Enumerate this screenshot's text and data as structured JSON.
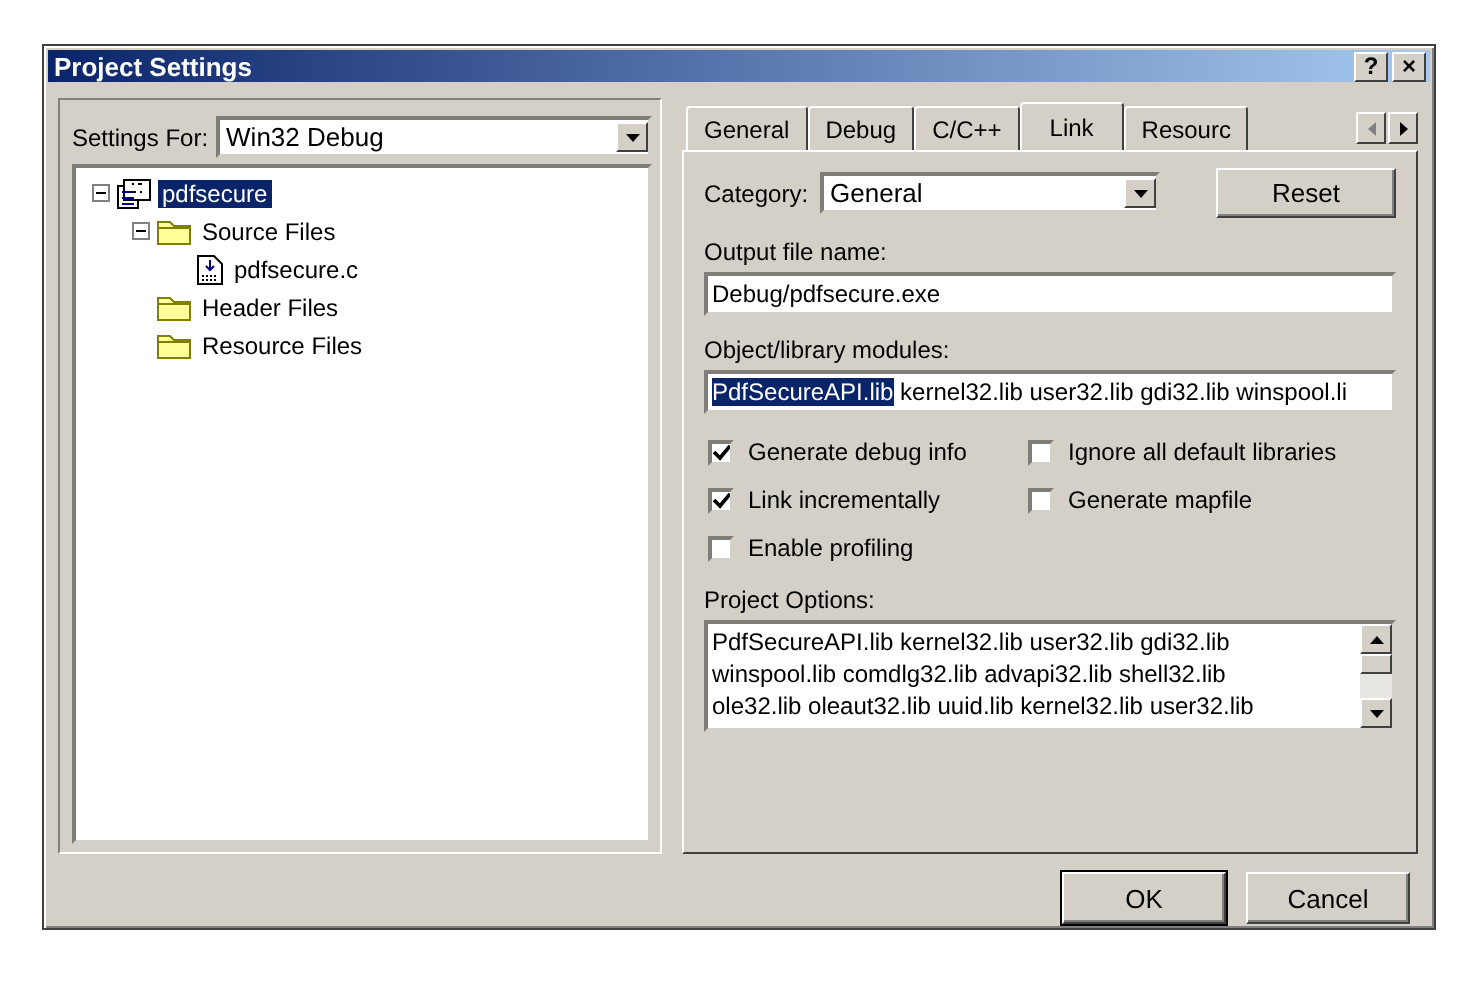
{
  "window": {
    "title": "Project Settings",
    "help_button": "?",
    "close_button": "×"
  },
  "settings_for": {
    "label": "Settings For:",
    "value": "Win32 Debug"
  },
  "tree": [
    {
      "label": "pdfsecure",
      "kind": "project",
      "selected": true,
      "expanded": true,
      "children": [
        {
          "label": "Source Files",
          "kind": "folder",
          "selected": false,
          "expanded": true,
          "children": [
            {
              "label": "pdfsecure.c",
              "kind": "file",
              "selected": false
            }
          ]
        },
        {
          "label": "Header Files",
          "kind": "folder",
          "selected": false
        },
        {
          "label": "Resource Files",
          "kind": "folder",
          "selected": false
        }
      ]
    }
  ],
  "tabs": [
    {
      "label": "General",
      "selected": false
    },
    {
      "label": "Debug",
      "selected": false
    },
    {
      "label": "C/C++",
      "selected": false
    },
    {
      "label": "Link",
      "selected": true
    },
    {
      "label": "Resourc",
      "selected": false
    }
  ],
  "category": {
    "label": "Category:",
    "value": "General"
  },
  "reset_button": "Reset",
  "output_file": {
    "label": "Output file name:",
    "value": "Debug/pdfsecure.exe"
  },
  "modules": {
    "label": "Object/library modules:",
    "selected_text": "PdfSecureAPI.lib",
    "value": "kernel32.lib user32.lib gdi32.lib winspool.li"
  },
  "checkboxes": [
    {
      "label": "Generate debug info",
      "checked": true
    },
    {
      "label": "Ignore all default libraries",
      "checked": false
    },
    {
      "label": "Link incrementally",
      "checked": true
    },
    {
      "label": "Generate mapfile",
      "checked": false
    },
    {
      "label": "Enable profiling",
      "checked": false
    }
  ],
  "project_options": {
    "label": "Project Options:",
    "lines": [
      "PdfSecureAPI.lib kernel32.lib user32.lib gdi32.lib",
      "winspool.lib comdlg32.lib advapi32.lib shell32.lib",
      "ole32.lib oleaut32.lib uuid.lib kernel32.lib user32.lib"
    ]
  },
  "buttons": [
    "OK",
    "Cancel"
  ]
}
